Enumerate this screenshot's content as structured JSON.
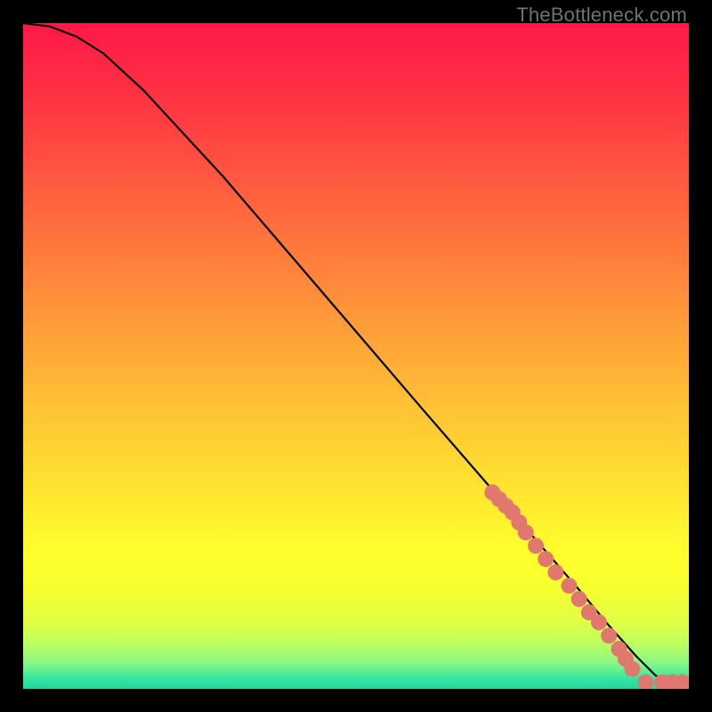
{
  "watermark": "TheBottleneck.com",
  "gradient_stops": [
    {
      "offset": 0.0,
      "color": "#ff1946"
    },
    {
      "offset": 0.1,
      "color": "#ff2f44"
    },
    {
      "offset": 0.22,
      "color": "#ff5440"
    },
    {
      "offset": 0.34,
      "color": "#ff793c"
    },
    {
      "offset": 0.46,
      "color": "#ff9e38"
    },
    {
      "offset": 0.58,
      "color": "#ffc334"
    },
    {
      "offset": 0.7,
      "color": "#ffe430"
    },
    {
      "offset": 0.8,
      "color": "#ffff2c"
    },
    {
      "offset": 0.85,
      "color": "#f7ff30"
    },
    {
      "offset": 0.9,
      "color": "#e0ff45"
    },
    {
      "offset": 0.93,
      "color": "#c0ff5c"
    },
    {
      "offset": 0.96,
      "color": "#8cf884"
    },
    {
      "offset": 0.985,
      "color": "#34e6a0"
    },
    {
      "offset": 1.0,
      "color": "#20d89c"
    }
  ],
  "chart_data": {
    "type": "line",
    "title": "",
    "xlabel": "",
    "ylabel": "",
    "x": [
      0.0,
      0.04,
      0.08,
      0.12,
      0.18,
      0.3,
      0.45,
      0.6,
      0.73,
      0.83,
      0.88,
      0.92,
      0.95,
      0.97,
      1.0
    ],
    "y": [
      1.0,
      0.995,
      0.98,
      0.955,
      0.9,
      0.77,
      0.595,
      0.42,
      0.27,
      0.155,
      0.095,
      0.05,
      0.02,
      0.01,
      0.01
    ],
    "xlim": [
      0,
      1
    ],
    "ylim": [
      0,
      1
    ],
    "marker_color": "#e07870",
    "marker_radius_px": 9,
    "markers_x": [
      0.705,
      0.715,
      0.725,
      0.735,
      0.745,
      0.755,
      0.77,
      0.785,
      0.8,
      0.82,
      0.835,
      0.85,
      0.865,
      0.88,
      0.895,
      0.905,
      0.915,
      0.935,
      0.96,
      0.975,
      0.99
    ],
    "markers_y": [
      0.295,
      0.285,
      0.275,
      0.265,
      0.25,
      0.235,
      0.215,
      0.195,
      0.175,
      0.155,
      0.135,
      0.115,
      0.1,
      0.08,
      0.06,
      0.045,
      0.03,
      0.01,
      0.01,
      0.01,
      0.01
    ]
  }
}
